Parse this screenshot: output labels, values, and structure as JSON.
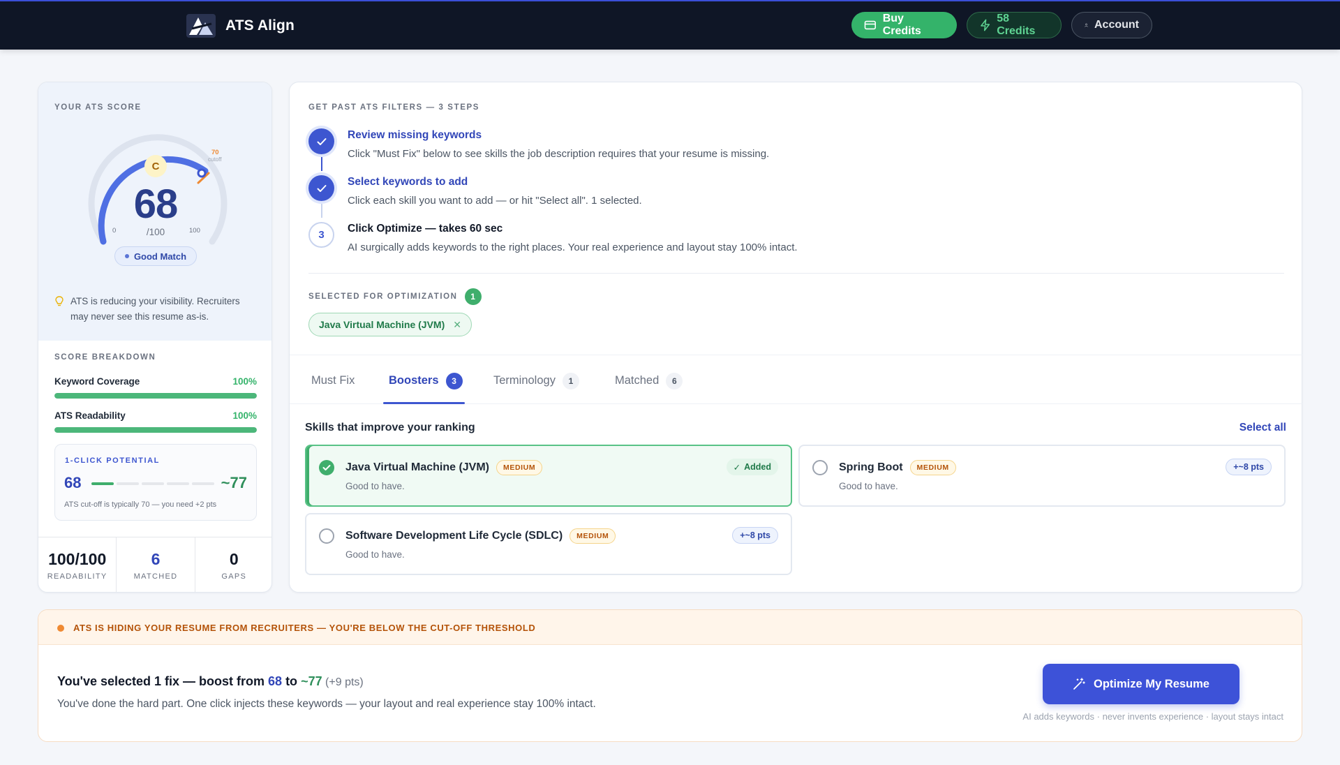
{
  "app": {
    "name": "ATS Align"
  },
  "topbar": {
    "buy_label": "Buy Credits",
    "credits_label": "58 Credits",
    "account_label": "Account"
  },
  "score": {
    "label": "YOUR ATS SCORE",
    "value": 68,
    "value_text": "68",
    "max_text": "/100",
    "grade": "C",
    "gauge_min": "0",
    "gauge_max": "100",
    "cutoff_value": "70",
    "cutoff_label": "cutoff",
    "match_label": "Good Match",
    "warning": "ATS is reducing your visibility. Recruiters may never see this resume as-is."
  },
  "breakdown": {
    "label": "SCORE BREAKDOWN",
    "items": [
      {
        "label": "Keyword Coverage",
        "pct_text": "100%",
        "pct": 1.0
      },
      {
        "label": "ATS Readability",
        "pct_text": "100%",
        "pct": 1.0
      }
    ]
  },
  "potential": {
    "label": "1-CLICK POTENTIAL",
    "from": "68",
    "to": "~77",
    "progress_segments": 5,
    "filled_segments": 1,
    "note": "ATS cut-off is typically 70 — you need +2 pts"
  },
  "stats": [
    {
      "value": "100/100",
      "label": "READABILITY"
    },
    {
      "value": "6",
      "label": "MATCHED"
    },
    {
      "value": "0",
      "label": "GAPS"
    }
  ],
  "steps": {
    "label": "GET PAST ATS FILTERS — 3 STEPS",
    "items": [
      {
        "title": "Review missing keywords",
        "desc": "Click \"Must Fix\" below to see skills the job description requires that your resume is missing.",
        "done": true
      },
      {
        "title": "Select keywords to add",
        "desc": "Click each skill you want to add — or hit \"Select all\". 1 selected.",
        "done": true
      },
      {
        "number": "3",
        "title": "Click Optimize — takes 60 sec",
        "desc": "AI surgically adds keywords to the right places. Your real experience and layout stay 100% intact.",
        "done": false
      }
    ]
  },
  "selected": {
    "label": "SELECTED FOR OPTIMIZATION",
    "count": "1",
    "chips": [
      "Java Virtual Machine (JVM)"
    ]
  },
  "tabs": [
    {
      "label": "Must Fix",
      "count": ""
    },
    {
      "label": "Boosters",
      "count": "3"
    },
    {
      "label": "Terminology",
      "count": "1"
    },
    {
      "label": "Matched",
      "count": "6"
    }
  ],
  "skills": {
    "title": "Skills that improve your ranking",
    "select_all": "Select all",
    "items": [
      {
        "name": "Java Virtual Machine (JVM)",
        "level": "MEDIUM",
        "sub": "Good to have.",
        "badge": "Added",
        "selected": true
      },
      {
        "name": "Spring Boot",
        "level": "MEDIUM",
        "sub": "Good to have.",
        "badge": "+~8 pts",
        "selected": false
      },
      {
        "name": "Software Development Life Cycle (SDLC)",
        "level": "MEDIUM",
        "sub": "Good to have.",
        "badge": "+~8 pts",
        "selected": false
      }
    ]
  },
  "banner": {
    "warning": "ATS IS HIDING YOUR RESUME FROM RECRUITERS — YOU'RE BELOW THE CUT-OFF THRESHOLD",
    "head_a": "You've selected 1 fix — boost from ",
    "head_from": "68",
    "head_to_word": " to ",
    "head_to": "~77",
    "head_pts": " (+9 pts)",
    "sub": "You've done the hard part. One click injects these keywords — your layout and real experience stay 100% intact.",
    "button": "Optimize My Resume",
    "note": "AI adds keywords · never invents experience · layout stays intact"
  },
  "colors": {
    "brand_blue": "#3d56d0",
    "green": "#34b36a",
    "orange": "#ef8a33",
    "topbar": "#0f1626"
  }
}
